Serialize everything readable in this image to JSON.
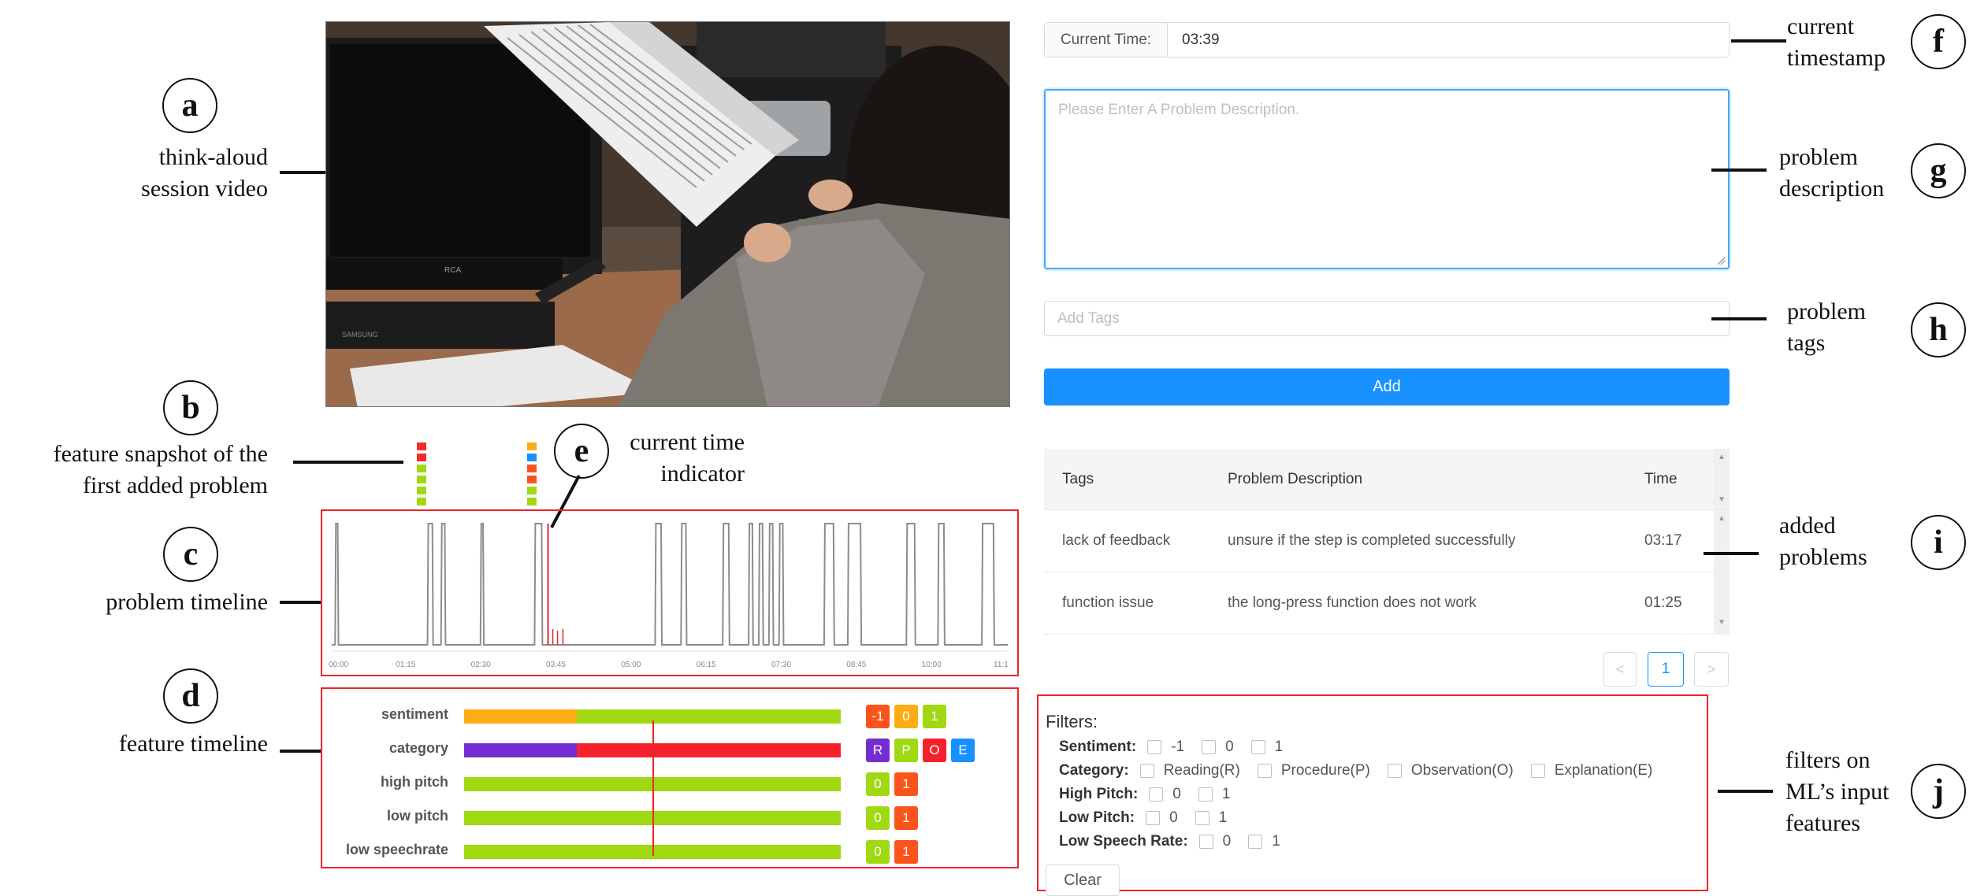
{
  "annotations": {
    "a": {
      "letter": "a",
      "lines": [
        "think-aloud",
        "session video"
      ]
    },
    "b": {
      "letter": "b",
      "lines": [
        "feature snapshot of the",
        "first added problem"
      ]
    },
    "c": {
      "letter": "c",
      "lines": [
        "problem timeline"
      ]
    },
    "d": {
      "letter": "d",
      "lines": [
        "feature timeline"
      ]
    },
    "e": {
      "letter": "e",
      "lines": [
        "current time",
        "indicator"
      ]
    },
    "f": {
      "letter": "f",
      "lines": [
        "current",
        "timestamp"
      ]
    },
    "g": {
      "letter": "g",
      "lines": [
        "problem",
        "description"
      ]
    },
    "h": {
      "letter": "h",
      "lines": [
        "problem",
        "tags"
      ]
    },
    "i": {
      "letter": "i",
      "lines": [
        "added",
        "problems"
      ]
    },
    "j": {
      "letter": "j",
      "lines": [
        "filters on",
        "ML’s input",
        "features"
      ]
    }
  },
  "video": {
    "tv_brand": "RCA",
    "dvd_brand": "SAMSUNG"
  },
  "snapshot_colors": {
    "first": [
      "#f52a2a",
      "#f52a2a",
      "#a0d911",
      "#a0d911",
      "#a0d911",
      "#a0d911"
    ],
    "second": [
      "#faad14",
      "#1890ff",
      "#fa541c",
      "#fa541c",
      "#a0d911",
      "#a0d911"
    ]
  },
  "problem_timeline": {
    "ticks": [
      "00:00",
      "01:15",
      "02:30",
      "03:45",
      "05:00",
      "06:15",
      "07:30",
      "08:45",
      "10:00",
      "11:1"
    ],
    "pulses": [
      [
        0.3,
        0.6
      ],
      [
        8.5,
        9.0
      ],
      [
        9.7,
        10.1
      ],
      [
        13.2,
        13.5
      ],
      [
        18.0,
        18.7
      ],
      [
        28.7,
        29.3
      ],
      [
        31.0,
        31.5
      ],
      [
        34.7,
        35.3
      ],
      [
        37.0,
        37.4
      ],
      [
        37.9,
        38.3
      ],
      [
        38.8,
        39.2
      ],
      [
        39.7,
        40.1
      ],
      [
        43.7,
        44.6
      ],
      [
        45.8,
        47.0
      ],
      [
        51.0,
        51.8
      ],
      [
        53.8,
        54.4
      ],
      [
        57.7,
        58.8
      ]
    ],
    "current_time_fraction": 0.32
  },
  "feature_timeline": {
    "rows": [
      {
        "label": "sentiment",
        "segments": [
          {
            "from": 0.0,
            "to": 0.3,
            "color": "#faad14"
          },
          {
            "from": 0.3,
            "to": 1.0,
            "color": "#a0d911"
          }
        ],
        "chips": [
          {
            "text": "-1",
            "color": "#fa541c"
          },
          {
            "text": "0",
            "color": "#faad14"
          },
          {
            "text": "1",
            "color": "#a0d911"
          }
        ]
      },
      {
        "label": "category",
        "segments": [
          {
            "from": 0.0,
            "to": 0.3,
            "color": "#722ed1"
          },
          {
            "from": 0.3,
            "to": 1.0,
            "color": "#f5222d"
          }
        ],
        "chips": [
          {
            "text": "R",
            "color": "#722ed1"
          },
          {
            "text": "P",
            "color": "#a0d911"
          },
          {
            "text": "O",
            "color": "#f5222d"
          },
          {
            "text": "E",
            "color": "#1890ff"
          }
        ]
      },
      {
        "label": "high pitch",
        "segments": [
          {
            "from": 0.0,
            "to": 1.0,
            "color": "#a0d911"
          }
        ],
        "chips": [
          {
            "text": "0",
            "color": "#a0d911"
          },
          {
            "text": "1",
            "color": "#fa541c"
          }
        ]
      },
      {
        "label": "low pitch",
        "segments": [
          {
            "from": 0.0,
            "to": 1.0,
            "color": "#a0d911"
          }
        ],
        "chips": [
          {
            "text": "0",
            "color": "#a0d911"
          },
          {
            "text": "1",
            "color": "#fa541c"
          }
        ]
      },
      {
        "label": "low speechrate",
        "segments": [
          {
            "from": 0.0,
            "to": 1.0,
            "color": "#a0d911"
          }
        ],
        "chips": [
          {
            "text": "0",
            "color": "#a0d911"
          },
          {
            "text": "1",
            "color": "#fa541c"
          }
        ]
      }
    ],
    "current_time_fraction": 0.5
  },
  "form": {
    "current_time_label": "Current Time:",
    "current_time_value": "03:39",
    "description_placeholder": "Please Enter A Problem Description.",
    "tags_placeholder": "Add Tags",
    "add_button": "Add"
  },
  "table": {
    "headers": {
      "tags": "Tags",
      "description": "Problem Description",
      "time": "Time"
    },
    "rows": [
      {
        "tags": "lack of feedback",
        "description": "unsure if the step is completed successfully",
        "time": "03:17"
      },
      {
        "tags": "function issue",
        "description": "the long-press function does not work",
        "time": "01:25"
      }
    ],
    "pagination": {
      "prev": "<",
      "page": "1",
      "next": ">"
    }
  },
  "filters": {
    "title": "Filters:",
    "groups": [
      {
        "label": "Sentiment:",
        "options": [
          "-1",
          "0",
          "1"
        ]
      },
      {
        "label": "Category:",
        "options": [
          "Reading(R)",
          "Procedure(P)",
          "Observation(O)",
          "Explanation(E)"
        ]
      },
      {
        "label": "High Pitch:",
        "options": [
          "0",
          "1"
        ]
      },
      {
        "label": "Low Pitch:",
        "options": [
          "0",
          "1"
        ]
      },
      {
        "label": "Low Speech Rate:",
        "options": [
          "0",
          "1"
        ]
      }
    ],
    "clear_button": "Clear"
  },
  "colors": {
    "accent": "#1890ff",
    "annotation_red": "#e8262a",
    "indicator": "#e8262a"
  }
}
